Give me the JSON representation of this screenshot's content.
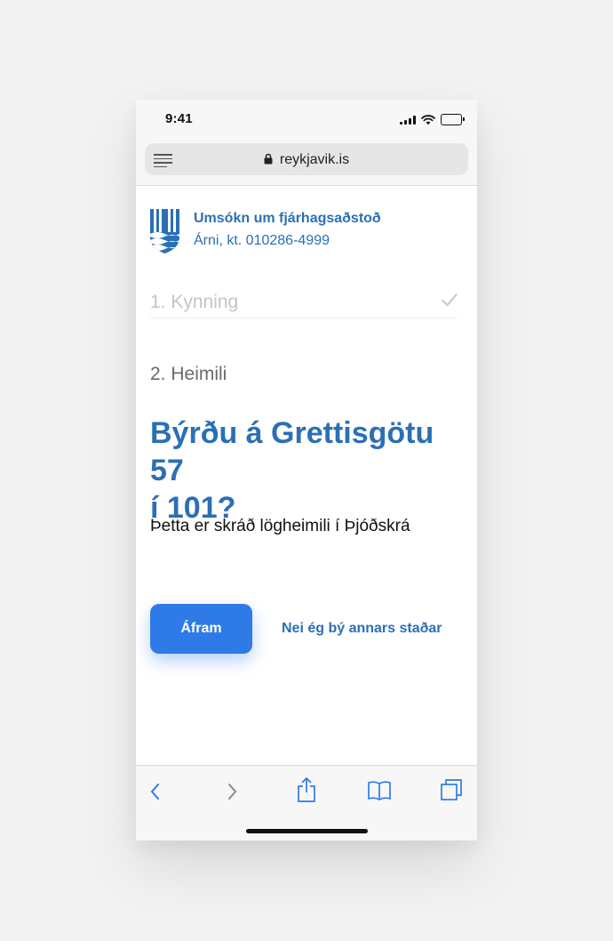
{
  "status": {
    "time": "9:41"
  },
  "browser": {
    "url": "reykjavik.is"
  },
  "header": {
    "title": "Umsókn um fjárhagsaðstoð",
    "subtitle": "Árni, kt. 010286-4999"
  },
  "steps": [
    {
      "label": "1. Kynning",
      "completed": true
    },
    {
      "label": "2. Heimili",
      "completed": false
    }
  ],
  "question": {
    "line1": "Býrðu á Grettisgötu 57",
    "line2": "í 101?",
    "description": "Þetta er skráð lögheimili í Þjóðskrá"
  },
  "actions": {
    "continue_label": "Áfram",
    "other_label": "Nei ég bý annars staðar"
  },
  "toolbar": {
    "icons": [
      "back-icon",
      "forward-icon",
      "share-icon",
      "bookmarks-icon",
      "tabs-icon"
    ]
  },
  "colors": {
    "brand": "#2b6fb5",
    "button": "#2e7be8",
    "muted": "#c4c4c4"
  }
}
